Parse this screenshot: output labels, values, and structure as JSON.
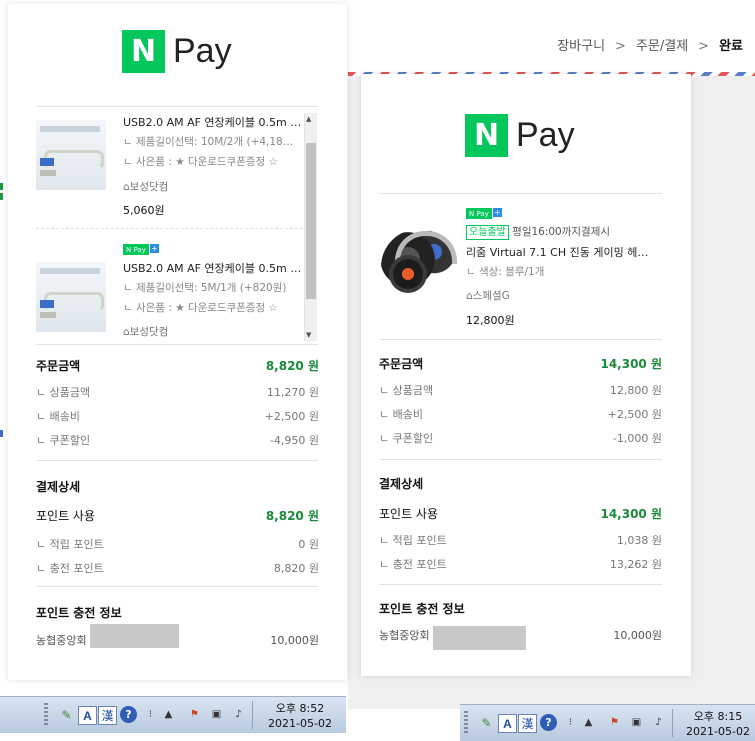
{
  "breadcrumb": {
    "step1": "장바구니",
    "sep": ">",
    "step2": "주문/결제",
    "step3": "완료"
  },
  "receipt_left": {
    "logo_mark": "N",
    "logo_text": "Pay",
    "items": [
      {
        "title": "USB2.0 AM AF 연장케이블 0.5m …",
        "option": "ㄴ 제품길이선택: 10M/2개 (+4,18…",
        "gift": "ㄴ 사은품 : ★ 다운로드쿠폰증정 ☆",
        "seller": "보성닷컴",
        "price": "5,060원"
      },
      {
        "badge_npay": "N Pay",
        "badge_plus": "+",
        "title": "USB2.0 AM AF 연장케이블 0.5m …",
        "option": "ㄴ 제품길이선택: 5M/1개 (+820원)",
        "gift": "ㄴ 사은품 : ★ 다운로드쿠폰증정 ☆",
        "seller": "보성닷컴"
      }
    ],
    "order_total_label": "주문금액",
    "order_total_value": "8,820 원",
    "product_label": "ㄴ 상품금액",
    "product_value": "11,270 원",
    "shipping_label": "ㄴ 배송비",
    "shipping_value": "+2,500 원",
    "coupon_label": "ㄴ 쿠폰할인",
    "coupon_value": "-4,950 원",
    "pay_detail_title": "결제상세",
    "point_use_label": "포인트 사용",
    "point_use_value": "8,820 원",
    "saved_point_label": "ㄴ 적립 포인트",
    "saved_point_value": "0 원",
    "charge_point_label": "ㄴ 충전 포인트",
    "charge_point_value": "8,820 원",
    "charge_info_title": "포인트 충전 정보",
    "bank_label": "농협중앙회",
    "bank_value": "10,000원"
  },
  "receipt_right": {
    "logo_mark": "N",
    "logo_text": "Pay",
    "item": {
      "badge_npay": "N Pay",
      "badge_plus": "+",
      "today_badge": "오늘출발",
      "today_note": "평일16:00까지결제시",
      "title": "리줌 Virtual 7.1 CH 진동 게이밍 헤…",
      "option": "ㄴ 색상: 블루/1개",
      "seller": "스페셜G",
      "price": "12,800원"
    },
    "order_total_label": "주문금액",
    "order_total_value": "14,300 원",
    "product_label": "ㄴ 상품금액",
    "product_value": "12,800 원",
    "shipping_label": "ㄴ 배송비",
    "shipping_value": "+2,500 원",
    "coupon_label": "ㄴ 쿠폰할인",
    "coupon_value": "-1,000 원",
    "pay_detail_title": "결제상세",
    "point_use_label": "포인트 사용",
    "point_use_value": "14,300 원",
    "saved_point_label": "ㄴ 적립 포인트",
    "saved_point_value": "1,038 원",
    "charge_point_label": "ㄴ 충전 포인트",
    "charge_point_value": "13,262 원",
    "charge_info_title": "포인트 충전 정보",
    "bank_label": "농협중앙회",
    "bank_value": "10,000원"
  },
  "taskbar_left": {
    "ime_a": "A",
    "ime_han": "漢",
    "help": "?",
    "time": "오후 8:52",
    "date": "2021-05-02"
  },
  "taskbar_right": {
    "ime_a": "A",
    "ime_han": "漢",
    "help": "?",
    "time": "오후 8:15",
    "date": "2021-05-02"
  },
  "colors": {
    "brand_green": "#03c75a",
    "amount_green": "#1a8a3a"
  }
}
